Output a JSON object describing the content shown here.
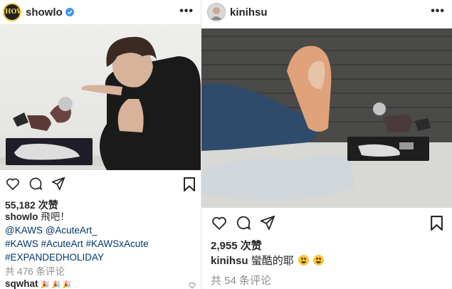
{
  "left_post": {
    "username": "showlo",
    "avatar_text": "SHOW",
    "likes": "55,182 次赞",
    "caption_user": "showlo",
    "caption_text": "飛吧！",
    "tags": [
      "@KAWS @AcuteArt_",
      "#KAWS #AcuteArt #KAWSxAcute",
      "#EXPANDEDHOLIDAY"
    ],
    "comments": "共 476 条评论",
    "commenter": "sqwhat",
    "commenter_emoji": "🎉 🎉 🎉"
  },
  "right_post": {
    "username": "kinihsu",
    "likes": "2,955 次赞",
    "caption_user": "kinihsu",
    "caption_text": "蠻酷的耶",
    "comments": "共 54 条评论"
  },
  "icons": {
    "more": "more-dots-icon",
    "like": "heart-icon",
    "comment": "comment-icon",
    "share": "share-icon",
    "save": "bookmark-icon",
    "verified": "verified-badge-icon"
  },
  "colors": {
    "link": "#00376b",
    "verified": "#3897f0",
    "secondary": "#8e8e8e"
  }
}
